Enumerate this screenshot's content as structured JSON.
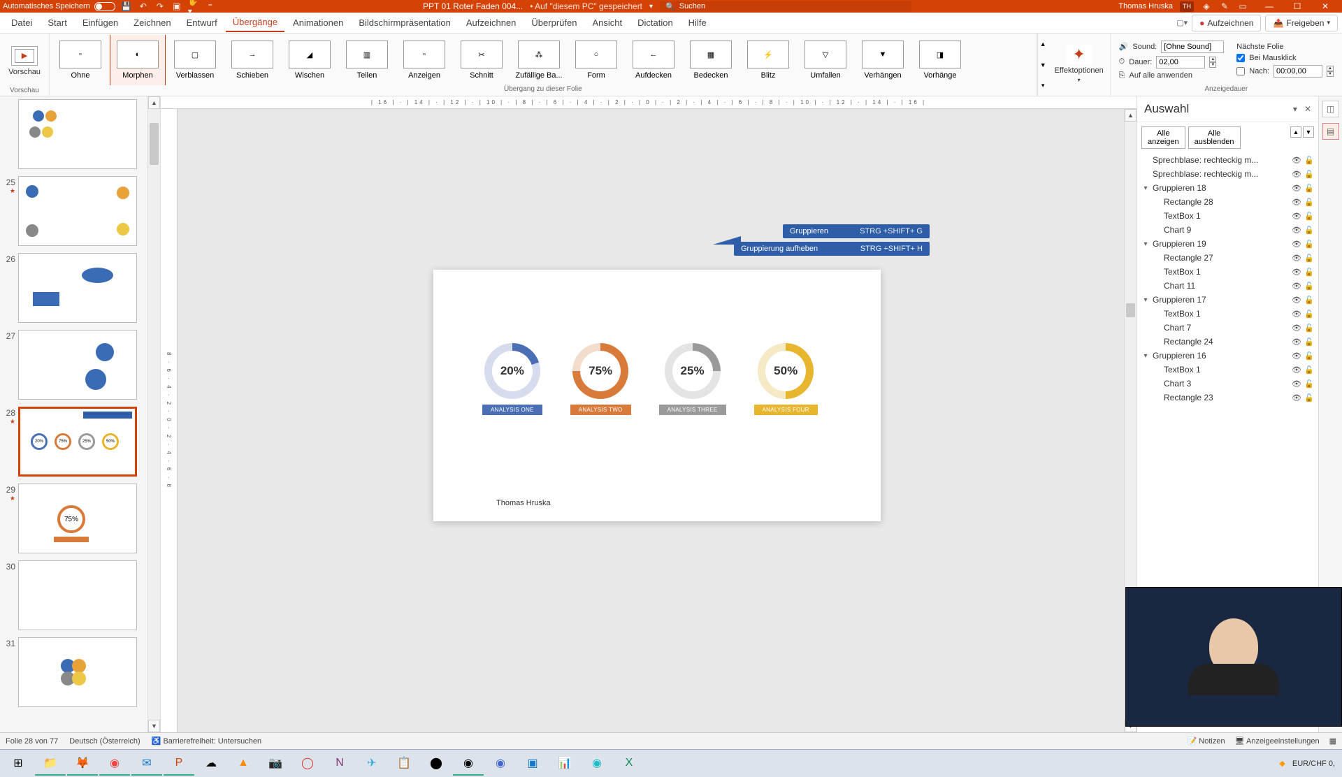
{
  "titlebar": {
    "autosave": "Automatisches Speichern",
    "filename": "PPT 01 Roter Faden 004...",
    "saved": "• Auf \"diesem PC\" gespeichert",
    "search_placeholder": "Suchen",
    "user": "Thomas Hruska",
    "user_initials": "TH"
  },
  "tabs": [
    "Datei",
    "Start",
    "Einfügen",
    "Zeichnen",
    "Entwurf",
    "Übergänge",
    "Animationen",
    "Bildschirmpräsentation",
    "Aufzeichnen",
    "Überprüfen",
    "Ansicht",
    "Dictation",
    "Hilfe"
  ],
  "active_tab": 5,
  "ribbon_actions": {
    "record": "Aufzeichnen",
    "share": "Freigeben"
  },
  "preview_btn": "Vorschau",
  "preview_group": "Vorschau",
  "transitions": [
    "Ohne",
    "Morphen",
    "Verblassen",
    "Schieben",
    "Wischen",
    "Teilen",
    "Anzeigen",
    "Schnitt",
    "Zufällige Ba...",
    "Form",
    "Aufdecken",
    "Bedecken",
    "Blitz",
    "Umfallen",
    "Verhängen",
    "Vorhänge"
  ],
  "transition_selected": 1,
  "transition_group_label": "Übergang zu dieser Folie",
  "effect_options": "Effektoptionen",
  "timing": {
    "sound_label": "Sound:",
    "sound_value": "[Ohne Sound]",
    "duration_label": "Dauer:",
    "duration_value": "02,00",
    "apply_all": "Auf alle anwenden",
    "advance_label": "Nächste Folie",
    "on_click": "Bei Mausklick",
    "after_label": "Nach:",
    "after_value": "00:00,00",
    "group_label": "Anzeigedauer"
  },
  "ruler_text": "| 16 | · | 14 | · | 12 | · | 10 | · | 8 | · | 6 | · | 4 | · | 2 | · | 0 | · | 2 | · | 4 | · | 6 | · | 8 | · | 10 | · | 12 | · | 14 | · | 16 |",
  "ruler_v_text": "8 · 6 · 4 · 2 · 0 · 2 · 4 · 6 · 8",
  "thumbnails": [
    {
      "num": "",
      "star": ""
    },
    {
      "num": "25",
      "star": "★"
    },
    {
      "num": "26",
      "star": ""
    },
    {
      "num": "27",
      "star": ""
    },
    {
      "num": "28",
      "star": "★",
      "selected": true
    },
    {
      "num": "29",
      "star": "★"
    },
    {
      "num": "30",
      "star": ""
    },
    {
      "num": "31",
      "star": ""
    }
  ],
  "callouts": {
    "group": "Gruppieren",
    "group_key": "STRG +SHIFT+ G",
    "ungroup": "Gruppierung aufheben",
    "ungroup_key": "STRG +SHIFT+ H"
  },
  "chart_data": {
    "type": "pie",
    "series": [
      {
        "name": "ANALYSIS ONE",
        "value": 20,
        "color": "#4a6fb5",
        "track": "#d6dced"
      },
      {
        "name": "ANALYSIS TWO",
        "value": 75,
        "color": "#d87b3a",
        "track": "#f2ddcd"
      },
      {
        "name": "ANALYSIS THREE",
        "value": 25,
        "color": "#9a9a9a",
        "track": "#e4e4e4"
      },
      {
        "name": "ANALYSIS FOUR",
        "value": 50,
        "color": "#e8b52e",
        "track": "#f6e9c6"
      }
    ]
  },
  "author": "Thomas Hruska",
  "selection": {
    "title": "Auswahl",
    "show_all": "Alle anzeigen",
    "hide_all": "Alle ausblenden",
    "items": [
      {
        "name": "Sprechblase: rechteckig m...",
        "indent": 0
      },
      {
        "name": "Sprechblase: rechteckig m...",
        "indent": 0
      },
      {
        "name": "Gruppieren 18",
        "indent": 0,
        "exp": true
      },
      {
        "name": "Rectangle 28",
        "indent": 1
      },
      {
        "name": "TextBox 1",
        "indent": 1
      },
      {
        "name": "Chart 9",
        "indent": 1
      },
      {
        "name": "Gruppieren 19",
        "indent": 0,
        "exp": true
      },
      {
        "name": "Rectangle 27",
        "indent": 1
      },
      {
        "name": "TextBox 1",
        "indent": 1
      },
      {
        "name": "Chart 11",
        "indent": 1
      },
      {
        "name": "Gruppieren 17",
        "indent": 0,
        "exp": true
      },
      {
        "name": "TextBox 1",
        "indent": 1
      },
      {
        "name": "Chart 7",
        "indent": 1
      },
      {
        "name": "Rectangle 24",
        "indent": 1
      },
      {
        "name": "Gruppieren 16",
        "indent": 0,
        "exp": true
      },
      {
        "name": "TextBox 1",
        "indent": 1
      },
      {
        "name": "Chart 3",
        "indent": 1
      },
      {
        "name": "Rectangle 23",
        "indent": 1
      }
    ]
  },
  "status": {
    "slide": "Folie 28 von 77",
    "lang": "Deutsch (Österreich)",
    "access": "Barrierefreiheit: Untersuchen",
    "notes": "Notizen",
    "display": "Anzeigeeinstellungen"
  },
  "taskbar": {
    "ticker": "EUR/CHF  0,"
  }
}
